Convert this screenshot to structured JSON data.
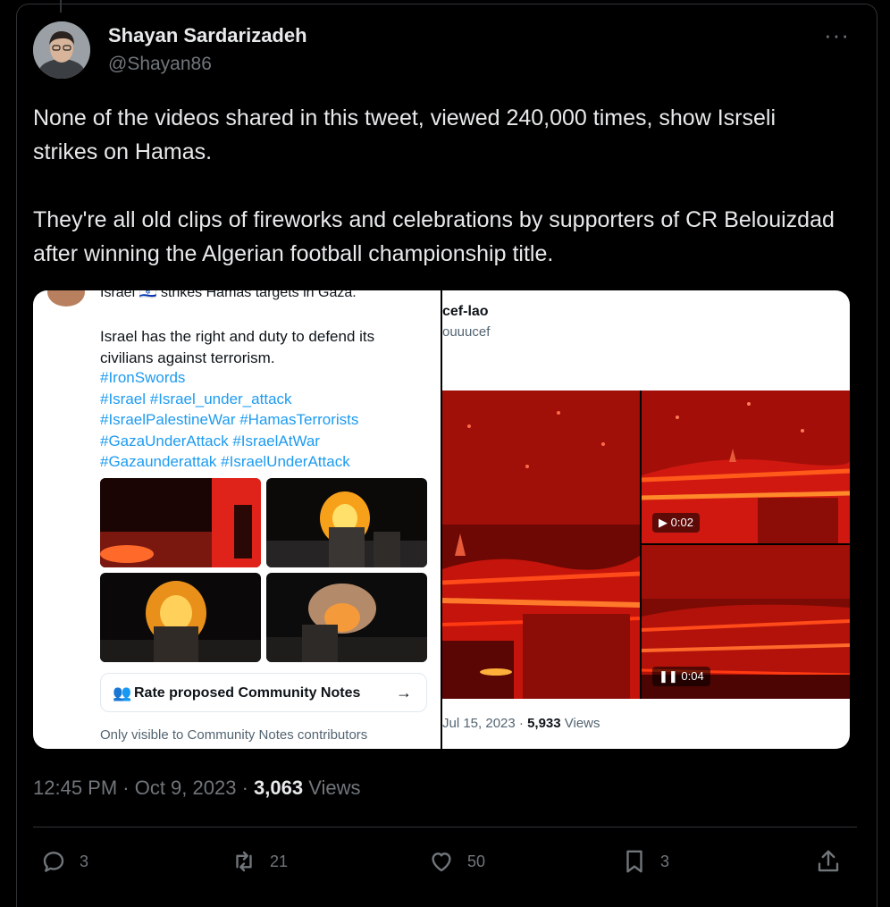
{
  "author": {
    "name": "Shayan Sardarizadeh",
    "handle": "@Shayan86"
  },
  "more_label": "···",
  "tweet": {
    "paragraph1": "None of the videos shared in this tweet, viewed 240,000 times, show Isrseli strikes on Hamas.",
    "paragraph2": "They're all old clips of fireworks and celebrations by supporters of CR Belouizdad after winning the Algerian football championship title."
  },
  "embedded_left": {
    "top_line": "Israel 🇮🇱 strikes Hamas targets in Gaza.",
    "body": "Israel has the right and duty to defend its civilians against terrorism.",
    "tags": [
      "#IronSwords",
      "#Israel #Israel_under_attack",
      "#IsraelPalestineWar #HamasTerrorists",
      "#GazaUnderAttack #IsraelAtWar",
      "#Gazaunderattak #IsraelUnderAttack"
    ],
    "notes_button": "Rate proposed Community Notes",
    "notes_arrow": "→",
    "only_visible": "Only visible to Community Notes contributors"
  },
  "embedded_right": {
    "name": "cef-lao",
    "handle": "ouuucef",
    "video1_time": "0:02",
    "video2_time": "0:04",
    "play_glyph": "▶",
    "pause_glyph": "❚❚",
    "date": "Jul 15, 2023 · ",
    "views_count": "5,933",
    "views_label": " Views"
  },
  "timestamp": {
    "time": "12:45 PM · Oct 9, 2023 · ",
    "views": "3,063",
    "views_label": " Views"
  },
  "actions": {
    "replies": "3",
    "retweets": "21",
    "likes": "50",
    "bookmarks": "3"
  },
  "colors": {
    "background": "#000000",
    "text": "#e7e9ea",
    "secondary": "#71767b",
    "link": "#1d9bf0",
    "fire_red": "#c4140b"
  }
}
